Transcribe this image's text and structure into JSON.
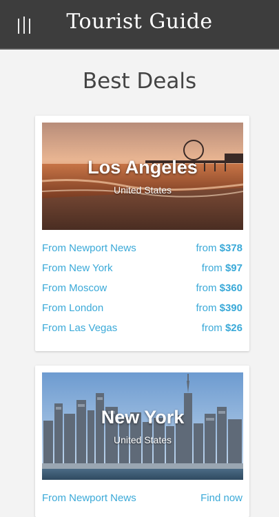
{
  "header": {
    "title": "Tourist Guide",
    "menu_icon": "menu-icon"
  },
  "page": {
    "title": "Best Deals"
  },
  "deals": [
    {
      "city": "Los Angeles",
      "country": "United States",
      "routes": [
        {
          "origin": "From Newport News",
          "price_prefix": "from",
          "price": "$378"
        },
        {
          "origin": "From New York",
          "price_prefix": "from",
          "price": "$97"
        },
        {
          "origin": "From Moscow",
          "price_prefix": "from",
          "price": "$360"
        },
        {
          "origin": "From London",
          "price_prefix": "from",
          "price": "$390"
        },
        {
          "origin": "From Las Vegas",
          "price_prefix": "from",
          "price": "$26"
        }
      ]
    },
    {
      "city": "New York",
      "country": "United States",
      "routes": [
        {
          "origin": "From Newport News",
          "price_prefix": "",
          "price": "Find now"
        }
      ]
    }
  ],
  "colors": {
    "link": "#3aa9d8",
    "appbar": "#3d3d3d"
  }
}
